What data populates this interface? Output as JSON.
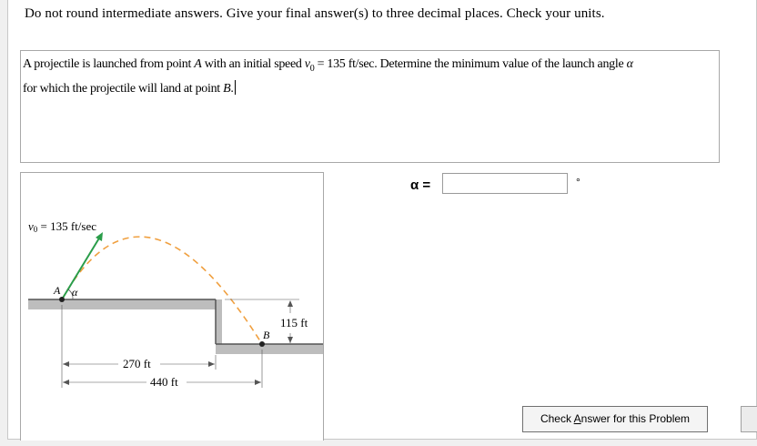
{
  "instructions": "Do not round intermediate answers.  Give your final answer(s) to three decimal places.  Check your units.",
  "problem": {
    "part1": "A projectile is launched from point ",
    "pointA": "A",
    "part2": " with an initial speed ",
    "v": "v",
    "v_sub": "0",
    "part3": " = 135 ft/sec. Determine the minimum value of the launch angle ",
    "alpha": "α",
    "part4": "for which the projectile will land at point ",
    "pointB": "B",
    "part5": "."
  },
  "figure": {
    "v0_label_sym": "v",
    "v0_label_sub": "0",
    "v0_label_rest": " = 135 ft/sec",
    "point_a": "A",
    "angle_label": "α",
    "point_b": "B",
    "height_label": "115 ft",
    "dist1_label": "270 ft",
    "dist2_label": "440 ft",
    "colors": {
      "trajectory": "#f0a040",
      "velocity": "#2a9d4a",
      "ground": "#bdbdbd"
    }
  },
  "answer": {
    "label": "α =",
    "value": "",
    "unit": "°"
  },
  "check_button": {
    "pre": "Check ",
    "underlined": "A",
    "post": "nswer for this Problem"
  }
}
